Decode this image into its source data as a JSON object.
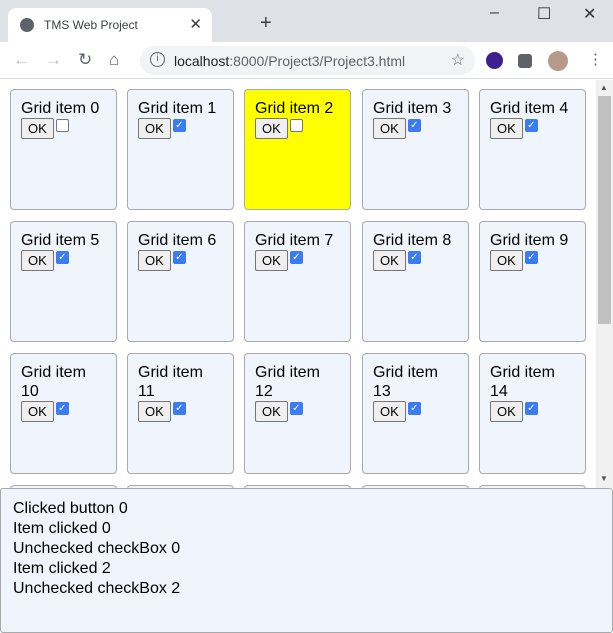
{
  "browser": {
    "tab_title": "TMS Web Project",
    "url_host": "localhost",
    "url_rest": ":8000/Project3/Project3.html"
  },
  "grid": {
    "button_label": "OK",
    "selected_index": 2,
    "items": [
      {
        "label": "Grid item 0",
        "checked": false
      },
      {
        "label": "Grid item 1",
        "checked": true
      },
      {
        "label": "Grid item 2",
        "checked": false
      },
      {
        "label": "Grid item 3",
        "checked": true
      },
      {
        "label": "Grid item 4",
        "checked": true
      },
      {
        "label": "Grid item 5",
        "checked": true
      },
      {
        "label": "Grid item 6",
        "checked": true
      },
      {
        "label": "Grid item 7",
        "checked": true
      },
      {
        "label": "Grid item 8",
        "checked": true
      },
      {
        "label": "Grid item 9",
        "checked": true
      },
      {
        "label": "Grid item 10",
        "checked": true
      },
      {
        "label": "Grid item 11",
        "checked": true
      },
      {
        "label": "Grid item 12",
        "checked": true
      },
      {
        "label": "Grid item 13",
        "checked": true
      },
      {
        "label": "Grid item 14",
        "checked": true
      }
    ],
    "partial_row_count": 5
  },
  "colors": {
    "selected": "#ffff00",
    "item_bg": "#f0f5fd",
    "checkbox": "#3b7cf3"
  },
  "log": {
    "lines": [
      "Clicked button 0",
      "Item clicked 0",
      "Unchecked checkBox 0",
      "Item clicked 2",
      "Unchecked checkBox 2"
    ]
  }
}
